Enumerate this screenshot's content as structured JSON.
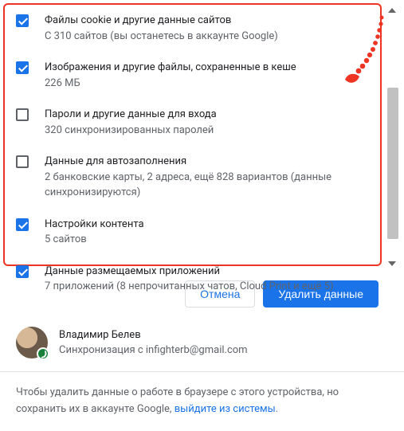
{
  "items": [
    {
      "checked": true,
      "title": "Файлы cookie и другие данные сайтов",
      "sub": "С 310 сайтов (вы останетесь в аккаунте Google)"
    },
    {
      "checked": true,
      "title": "Изображения и другие файлы, сохраненные в кеше",
      "sub": "226 МБ"
    },
    {
      "checked": false,
      "title": "Пароли и другие данные для входа",
      "sub": "320 синхронизированных паролей"
    },
    {
      "checked": false,
      "title": "Данные для автозаполнения",
      "sub": "2 банковские карты, 2 адреса, ещё 828 вариантов (данные синхронизируются)"
    },
    {
      "checked": true,
      "title": "Настройки контента",
      "sub": "5 сайтов"
    },
    {
      "checked": true,
      "title": "Данные размещаемых приложений",
      "sub": "7 приложений (8 непрочитанных чатов, Cloud Print и ещё 5)"
    }
  ],
  "actions": {
    "cancel": "Отмена",
    "confirm": "Удалить данные"
  },
  "profile": {
    "name": "Владимир Белев",
    "sync": "Синхронизация с infighterb@gmail.com"
  },
  "footer": {
    "text1": "Чтобы удалить данные о работе в браузере с этого устройства, но сохранить их в аккаунте Google, ",
    "link": "выйдите из системы",
    "text2": "."
  },
  "colors": {
    "accent": "#1a73e8",
    "annotation": "#ee3524"
  }
}
